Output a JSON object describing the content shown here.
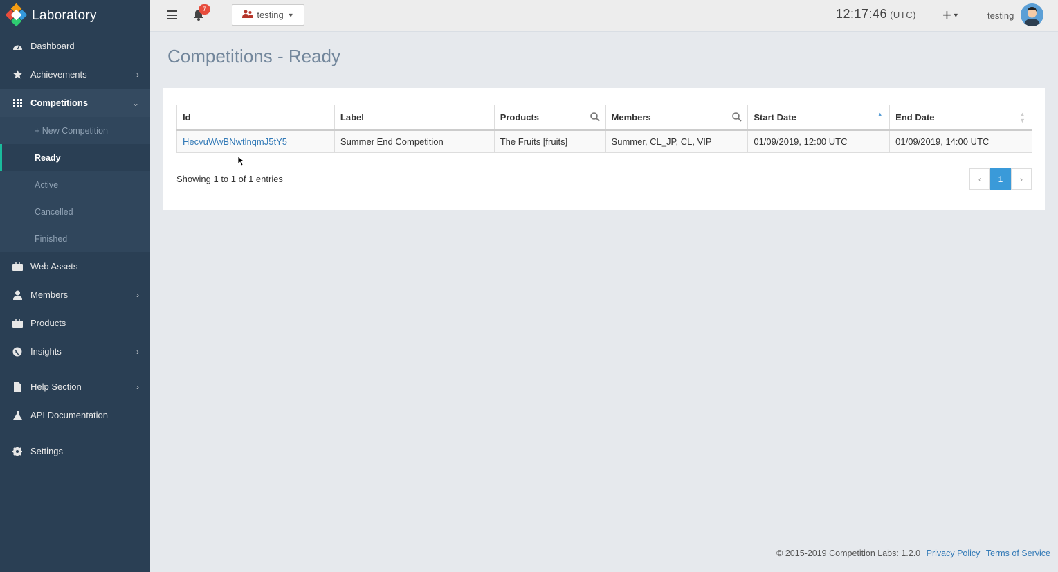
{
  "brand": {
    "name": "Laboratory"
  },
  "sidebar": {
    "items": [
      {
        "label": "Dashboard",
        "icon": "dashboard-icon",
        "has_chevron": false
      },
      {
        "label": "Achievements",
        "icon": "star-icon",
        "has_chevron": true
      },
      {
        "label": "Competitions",
        "icon": "grid-icon",
        "has_chevron": true,
        "expanded": true
      },
      {
        "label": "Web Assets",
        "icon": "briefcase-icon",
        "has_chevron": false
      },
      {
        "label": "Members",
        "icon": "user-icon",
        "has_chevron": true
      },
      {
        "label": "Products",
        "icon": "briefcase-icon",
        "has_chevron": false
      },
      {
        "label": "Insights",
        "icon": "globe-icon",
        "has_chevron": true
      },
      {
        "label": "Help Section",
        "icon": "file-icon",
        "has_chevron": true
      },
      {
        "label": "API Documentation",
        "icon": "flask-icon",
        "has_chevron": false
      },
      {
        "label": "Settings",
        "icon": "gear-icon",
        "has_chevron": false
      }
    ],
    "competitions_sub": [
      {
        "label": "+ New Competition"
      },
      {
        "label": "Ready",
        "current": true
      },
      {
        "label": "Active"
      },
      {
        "label": "Cancelled"
      },
      {
        "label": "Finished"
      }
    ]
  },
  "topbar": {
    "notifications_count": "7",
    "environment": "testing",
    "clock": "12:17:46",
    "timezone": "(UTC)",
    "add_label": "+",
    "user_name": "testing"
  },
  "page": {
    "title": "Competitions - Ready"
  },
  "table": {
    "columns": [
      "Id",
      "Label",
      "Products",
      "Members",
      "Start Date",
      "End Date"
    ],
    "rows": [
      {
        "id": "HecvuWwBNwtlnqmJ5tY5",
        "label": "Summer End Competition",
        "products": "The Fruits [fruits]",
        "members": "Summer, CL_JP, CL, VIP",
        "start_date": "01/09/2019, 12:00 UTC",
        "end_date": "01/09/2019, 14:00 UTC"
      }
    ],
    "info": "Showing 1 to 1 of 1 entries",
    "pagination": {
      "prev": "‹",
      "current": "1",
      "next": "›"
    }
  },
  "footer": {
    "copyright": "© 2015-2019 Competition Labs: 1.2.0",
    "privacy": "Privacy Policy",
    "terms": "Terms of Service"
  },
  "colors": {
    "sidebar": "#2a3f54",
    "accent": "#3a9ad9",
    "link": "#337ab7",
    "badge": "#e74c3c"
  }
}
